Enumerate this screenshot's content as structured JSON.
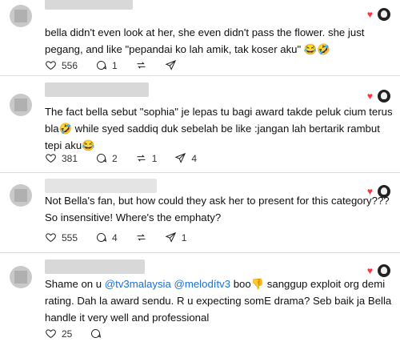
{
  "posts": [
    {
      "text": "bella didn't even look at her, she even didn't pass the flower. she just pegang, and like \"pepandai ko lah amik, tak koser aku\" 😂🤣",
      "likes": "556",
      "replies": "1",
      "reposts": "",
      "shares": ""
    },
    {
      "text": "The fact bella sebut \"sophia\" je lepas tu bagi award takde peluk cium terus bla🤣  while syed saddiq duk sebelah be like :jangan lah bertarik rambut tepi aku😂",
      "likes": "381",
      "replies": "2",
      "reposts": "1",
      "shares": "4"
    },
    {
      "text": "Not Bella's fan, but how could they ask her to present for this category??? So insensitive! Where's the emphaty?",
      "likes": "555",
      "replies": "4",
      "reposts": "",
      "shares": "1"
    },
    {
      "text_prefix": "Shame on u ",
      "mention1": "@tv3malaysia",
      "mention2": "@melodítv3",
      "text_suffix": " boo👎 sanggup exploit org demi rating. Dah la award sendu. R u expecting somE drama? Seb baik ja Bella handle it very well and professional",
      "likes": "25",
      "replies": "",
      "reposts": "",
      "shares": ""
    }
  ],
  "icons": {
    "like": "heart-icon",
    "reply": "comment-icon",
    "repost": "repost-icon",
    "share": "share-icon",
    "liked_by_author": "red-heart-icon"
  },
  "colors": {
    "mention": "#1d6fd1",
    "liked_heart": "#ff3040",
    "divider": "#dcdcdc"
  }
}
